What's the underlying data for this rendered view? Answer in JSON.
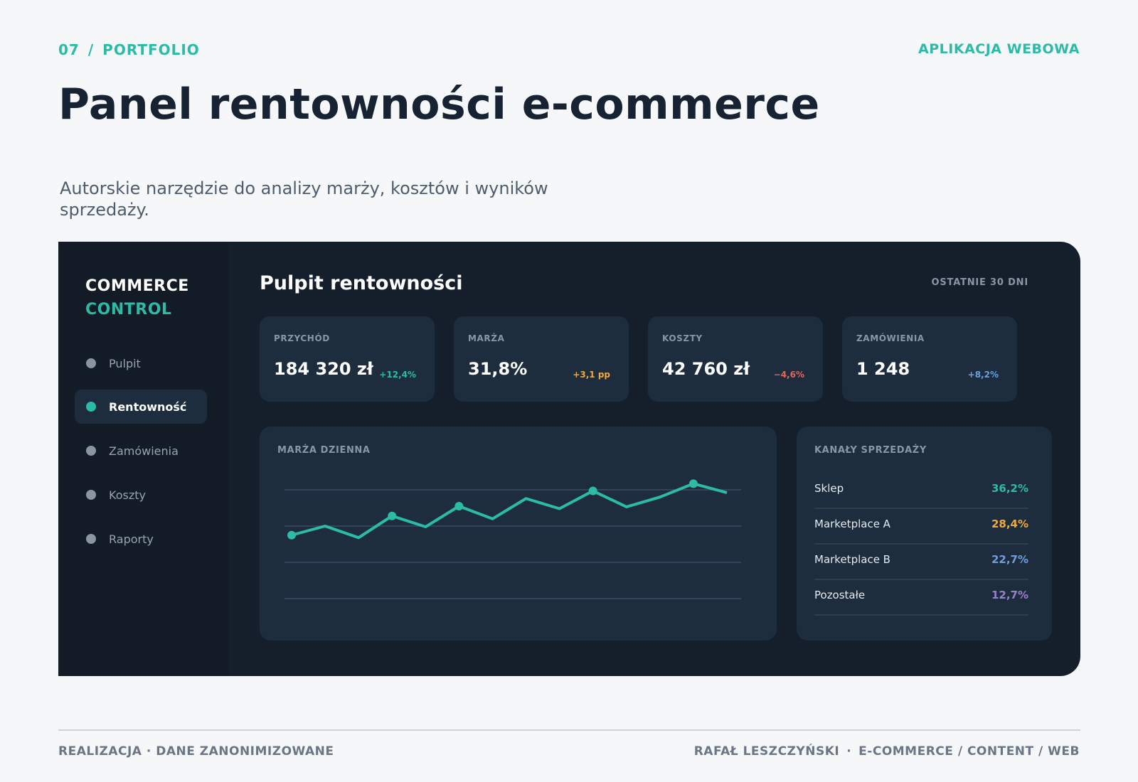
{
  "header": {
    "number": "07",
    "separator": "/",
    "section": "PORTFOLIO",
    "type": "APLIKACJA WEBOWA",
    "title": "Panel rentowności e-commerce",
    "subtitle": "Autorskie narzędzie do analizy marży, kosztów i wyników sprzedaży."
  },
  "sidebar": {
    "brand_line1": "COMMERCE",
    "brand_line2": "CONTROL",
    "items": [
      {
        "label": "Pulpit",
        "active": false
      },
      {
        "label": "Rentowność",
        "active": true
      },
      {
        "label": "Zamówienia",
        "active": false
      },
      {
        "label": "Koszty",
        "active": false
      },
      {
        "label": "Raporty",
        "active": false
      }
    ]
  },
  "dashboard": {
    "title": "Pulpit rentowności",
    "period": "OSTATNIE 30 DNI",
    "kpis": [
      {
        "label": "PRZYCHÓD",
        "value": "184 320 zł",
        "delta": "+12,4%",
        "color": "#2bbba7"
      },
      {
        "label": "MARŻA",
        "value": "31,8%",
        "delta": "+3,1 pp",
        "color": "#f0a93b"
      },
      {
        "label": "KOSZTY",
        "value": "42 760 zł",
        "delta": "−4,6%",
        "color": "#e2675a"
      },
      {
        "label": "ZAMÓWIENIA",
        "value": "1 248",
        "delta": "+8,2%",
        "color": "#6d9fe0"
      }
    ],
    "chart_label": "MARŻA DZIENNA",
    "channels_label": "KANAŁY SPRZEDAŻY",
    "channels": [
      {
        "name": "Sklep",
        "value": "36,2%",
        "color": "#2bbba7"
      },
      {
        "name": "Marketplace A",
        "value": "28,4%",
        "color": "#f0a93b"
      },
      {
        "name": "Marketplace B",
        "value": "22,7%",
        "color": "#6d9fe0"
      },
      {
        "name": "Pozostałe",
        "value": "12,7%",
        "color": "#9a7fcb"
      }
    ]
  },
  "chart_data": {
    "type": "line",
    "title": "MARŻA DZIENNA",
    "x": [
      1,
      2,
      3,
      4,
      5,
      6,
      7,
      8,
      9,
      10,
      11,
      12,
      13,
      14
    ],
    "values": [
      27.5,
      30.0,
      26.8,
      32.8,
      29.8,
      35.5,
      32.0,
      37.6,
      34.8,
      39.7,
      35.3,
      38.0,
      41.7,
      39.2
    ],
    "markers": [
      0,
      3,
      5,
      9,
      12
    ],
    "ylim": [
      10,
      40
    ],
    "grid": true,
    "line_color": "#2bbba7",
    "xlabel": "",
    "ylabel": ""
  },
  "footer": {
    "left": "REALIZACJA · DANE ZANONIMIZOWANE",
    "author": "RAFAŁ LESZCZYŃSKI",
    "dot": "·",
    "tags": "E-COMMERCE / CONTENT / WEB"
  }
}
